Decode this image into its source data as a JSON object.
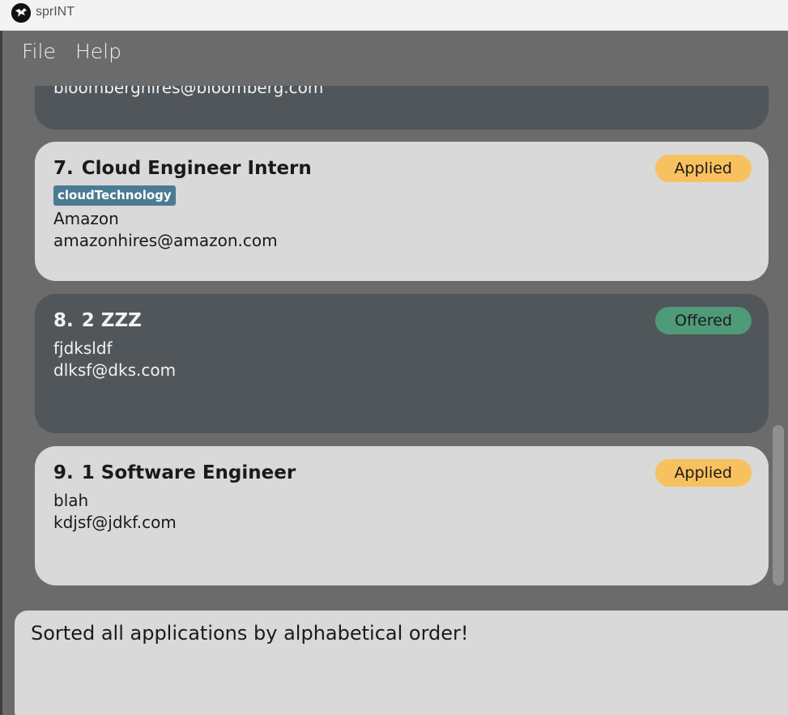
{
  "window": {
    "title": "sprINT"
  },
  "menu": {
    "items": [
      "File",
      "Help"
    ]
  },
  "applications": [
    {
      "index": "",
      "role": "",
      "tag": "",
      "company": "",
      "email": "bloomberghires@bloomberg.com",
      "status": "",
      "theme": "dark"
    },
    {
      "index": "7.",
      "role": "Cloud Engineer Intern",
      "tag": "cloudTechnology",
      "company": "Amazon",
      "email": "amazonhires@amazon.com",
      "status": "Applied",
      "theme": "light"
    },
    {
      "index": "8.",
      "role": "2 ZZZ",
      "tag": "",
      "company": "fjdksldf",
      "email": "dlksf@dks.com",
      "status": "Offered",
      "theme": "dark"
    },
    {
      "index": "9.",
      "role": "1 Software Engineer",
      "tag": "",
      "company": "blah",
      "email": "kdjsf@jdkf.com",
      "status": "Applied",
      "theme": "light"
    }
  ],
  "result": {
    "message": "Sorted all applications by alphabetical order!"
  },
  "colors": {
    "applied": "#f8c15f",
    "offered": "#4f9a78",
    "tag": "#4b7b92",
    "card_light": "#d9d9d9",
    "card_dark": "#51565a"
  },
  "icons": {
    "app": "sprint-logo-icon"
  }
}
